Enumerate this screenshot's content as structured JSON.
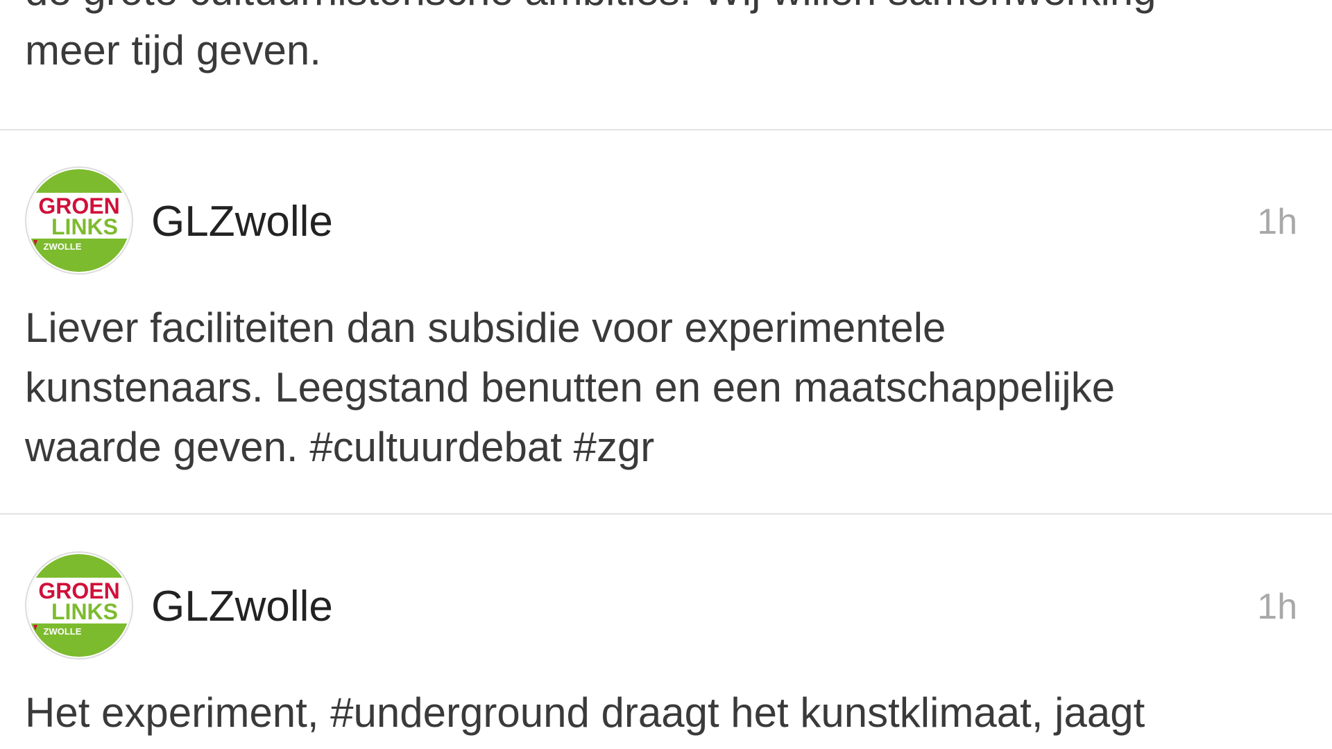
{
  "feed": {
    "top_partial": {
      "lines": [
        "de grote cultuurhistorische ambities. Wij willen samenwerking",
        "meer tijd geven."
      ]
    },
    "posts": [
      {
        "author": "GLZwolle",
        "time": "1h",
        "avatar": {
          "line1": "GROEN",
          "line2": "LINKS",
          "line3": "ZWOLLE",
          "green": "#7dbb2e",
          "red": "#d0103a"
        },
        "lines": [
          "Liever faciliteiten dan subsidie voor experimentele",
          "kunstenaars. Leegstand benutten en een maatschappelijke",
          "waarde geven. #cultuurdebat #zgr"
        ]
      },
      {
        "author": "GLZwolle",
        "time": "1h",
        "avatar": {
          "line1": "GROEN",
          "line2": "LINKS",
          "line3": "ZWOLLE",
          "green": "#7dbb2e",
          "red": "#d0103a"
        },
        "lines": [
          "Het experiment, #underground draagt het kunstklimaat, jaagt"
        ]
      }
    ]
  }
}
